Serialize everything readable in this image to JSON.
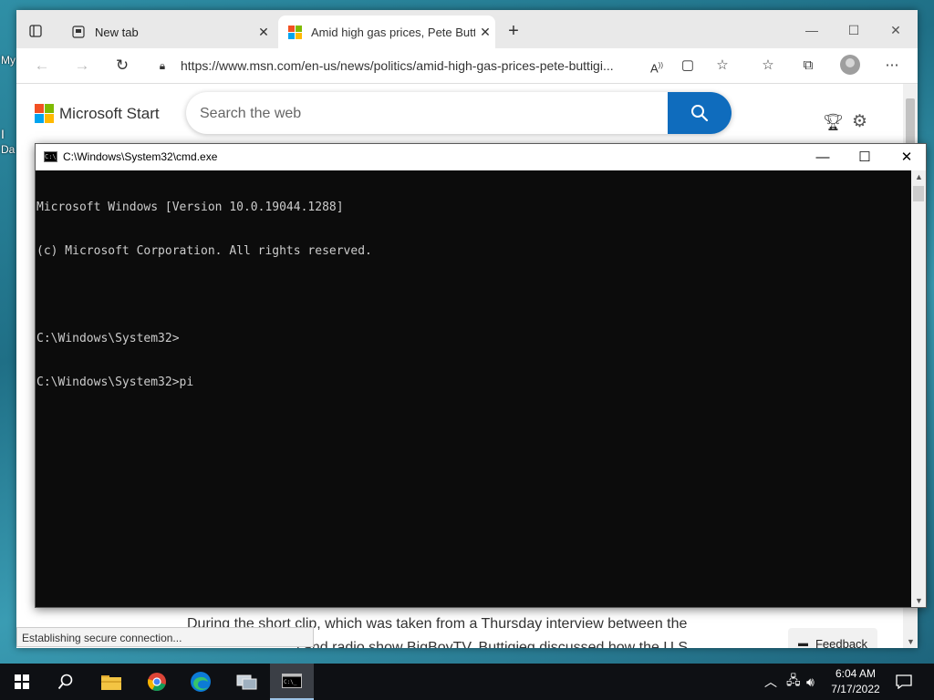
{
  "desktop": {
    "icon_labels": [
      "My",
      "I",
      "Da"
    ]
  },
  "browser": {
    "tabs": [
      {
        "label": "New tab",
        "active": false
      },
      {
        "label": "Amid high gas prices, Pete Buttig",
        "active": true
      }
    ],
    "address_bar": {
      "url": "https://www.msn.com/en-us/news/politics/amid-high-gas-prices-pete-buttigi..."
    },
    "status_text": "Establishing secure connection..."
  },
  "page": {
    "brand": "Microsoft Start",
    "search_placeholder": "Search the web",
    "article_lines": [
      "During the short clip, which was taken from a Thursday interview between the",
      "l and radio show BigBoyTV, Buttigieg discussed how the U.S."
    ],
    "feedback_label": "Feedback"
  },
  "cmd": {
    "title": "C:\\Windows\\System32\\cmd.exe",
    "lines": [
      "Microsoft Windows [Version 10.0.19044.1288]",
      "(c) Microsoft Corporation. All rights reserved.",
      "",
      "C:\\Windows\\System32>",
      "C:\\Windows\\System32>pi"
    ]
  },
  "taskbar": {
    "time": "6:04 AM",
    "date": "7/17/2022",
    "pinned_icons": [
      "windows-start-icon",
      "search-icon",
      "file-explorer-icon",
      "chrome-icon",
      "edge-icon",
      "network-app-icon",
      "cmd-icon"
    ]
  },
  "colors": {
    "ms_red": "#f25022",
    "ms_green": "#7fba00",
    "ms_blue": "#00a4ef",
    "ms_yellow": "#ffb900",
    "search_button": "#0f6cbd",
    "console_bg": "#0c0c0c",
    "console_text": "#cccccc"
  }
}
